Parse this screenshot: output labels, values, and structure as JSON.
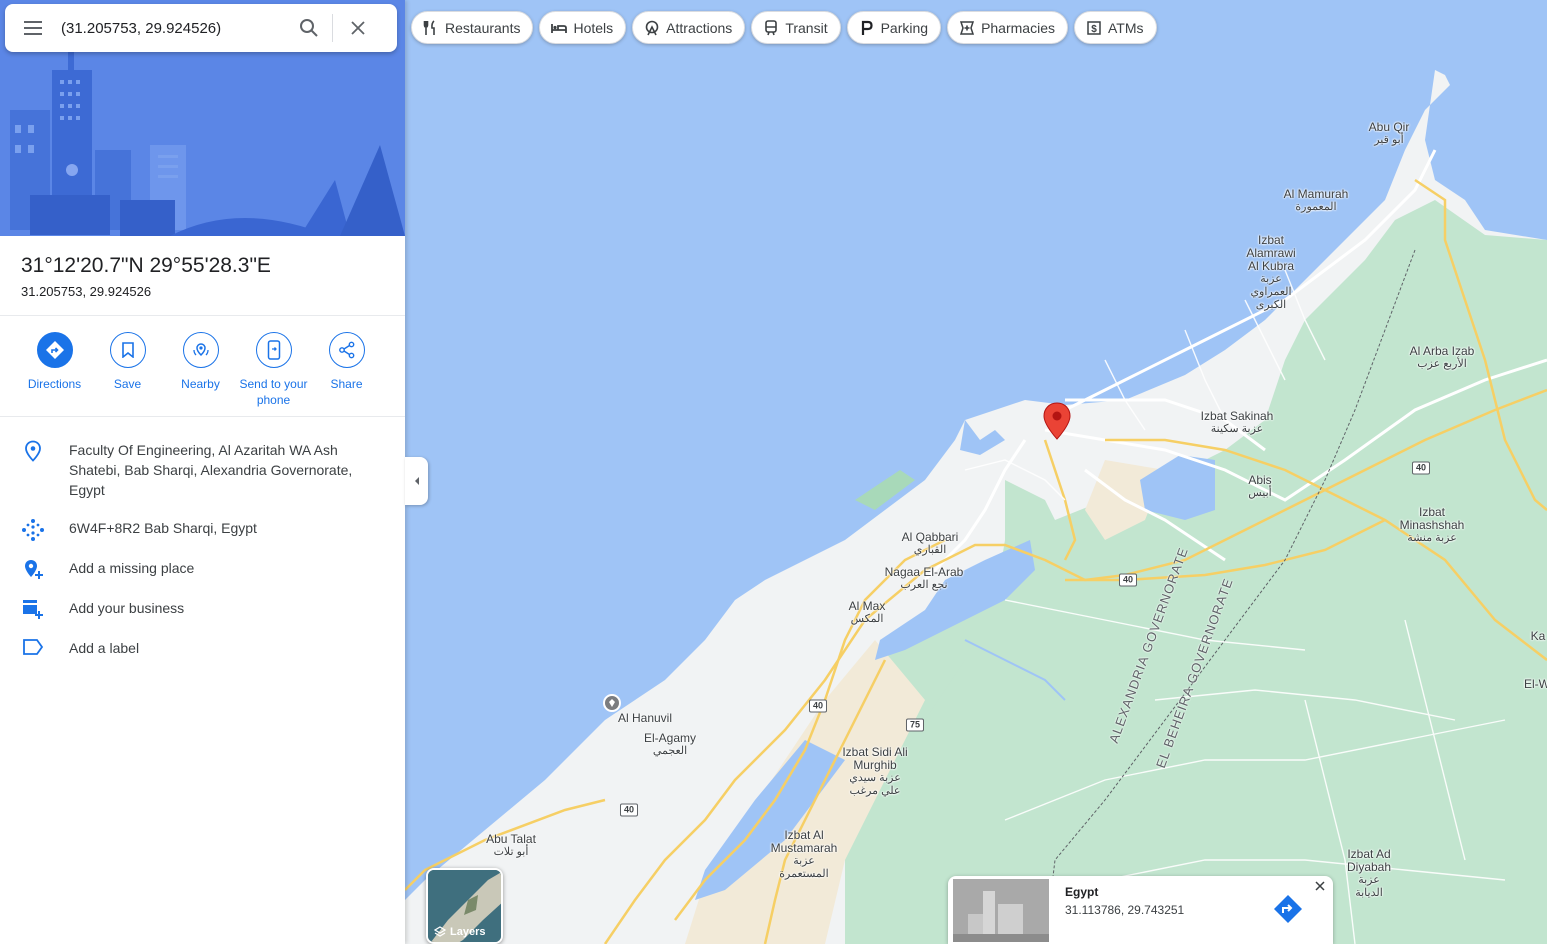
{
  "search": {
    "query": "(31.205753, 29.924526)"
  },
  "place": {
    "title": "31°12'20.7\"N 29°55'28.3\"E",
    "subtitle": "31.205753, 29.924526"
  },
  "actions": [
    {
      "label": "Directions",
      "icon": "directions-icon"
    },
    {
      "label": "Save",
      "icon": "bookmark-icon"
    },
    {
      "label": "Nearby",
      "icon": "nearby-icon"
    },
    {
      "label": "Send to your phone",
      "icon": "send-to-phone-icon"
    },
    {
      "label": "Share",
      "icon": "share-icon"
    }
  ],
  "info": {
    "address": "Faculty Of Engineering, Al Azaritah WA Ash Shatebi, Bab Sharqi, Alexandria Governorate, Egypt",
    "plus_code": "6W4F+8R2 Bab Sharqi, Egypt",
    "add_missing_place": "Add a missing place",
    "add_business": "Add your business",
    "add_label": "Add a label"
  },
  "chips": [
    {
      "label": "Restaurants",
      "icon": "restaurant-icon"
    },
    {
      "label": "Hotels",
      "icon": "hotel-icon"
    },
    {
      "label": "Attractions",
      "icon": "attraction-icon"
    },
    {
      "label": "Transit",
      "icon": "transit-icon"
    },
    {
      "label": "Parking",
      "icon": "parking-icon"
    },
    {
      "label": "Pharmacies",
      "icon": "pharmacy-icon"
    },
    {
      "label": "ATMs",
      "icon": "atm-icon"
    }
  ],
  "map_labels": {
    "abu_qir": {
      "en": "Abu Qir",
      "ar": "أبو قير"
    },
    "al_mamurah": {
      "en": "Al Mamurah",
      "ar": "المعمورة"
    },
    "izbat_alamrawi": {
      "en": "Izbat Alamrawi Al Kubra",
      "ar": "عزبة العمراوي الكبرى"
    },
    "al_arba_izab": {
      "en": "Al Arba Izab",
      "ar": "الأربع عزب"
    },
    "izbat_sakinah": {
      "en": "Izbat Sakinah",
      "ar": "عزبة سكينة"
    },
    "abis": {
      "en": "Abis",
      "ar": "أبيس"
    },
    "izbat_minashshah": {
      "en": "Izbat Minashshah",
      "ar": "عزبة منشة"
    },
    "al_qabbari": {
      "en": "Al Qabbari",
      "ar": "القباري"
    },
    "nagaa_el_arab": {
      "en": "Nagaa El-Arab",
      "ar": "نجع العرب"
    },
    "al_max": {
      "en": "Al Max",
      "ar": "المكس"
    },
    "al_hanuvil": {
      "en": "Al Hanuvil",
      "ar": ""
    },
    "el_agamy": {
      "en": "El-Agamy",
      "ar": "العجمي"
    },
    "izbat_sidi": {
      "en": "Izbat Sidi Ali Murghib",
      "ar": "عزبة سيدي علي مرغب"
    },
    "izbat_al_mustamarah": {
      "en": "Izbat Al Mustamarah",
      "ar": "عزبة المستعمرة"
    },
    "abu_talat": {
      "en": "Abu Talat",
      "ar": "أبو تلات"
    },
    "izbat_ad_diyabah": {
      "en": "Izbat Ad Diyabah",
      "ar": "عزبة الديابة"
    },
    "ka": {
      "en": "Ka",
      "ar": ""
    },
    "el_w": {
      "en": "El-W",
      "ar": ""
    },
    "alexandria_gov": "ALEXANDRIA GOVERNORATE",
    "beheira_gov": "EL BEHEIRA GOVERNORATE",
    "road_40": "40",
    "road_75": "75"
  },
  "layers": {
    "label": "Layers"
  },
  "card": {
    "title": "Egypt",
    "coords": "31.113786, 29.743251"
  },
  "colors": {
    "accent": "#1a73e8",
    "water": "#9fc4f6",
    "land": "#f1f3f4",
    "green": "#c2e5cf",
    "pin": "#ea4335"
  }
}
